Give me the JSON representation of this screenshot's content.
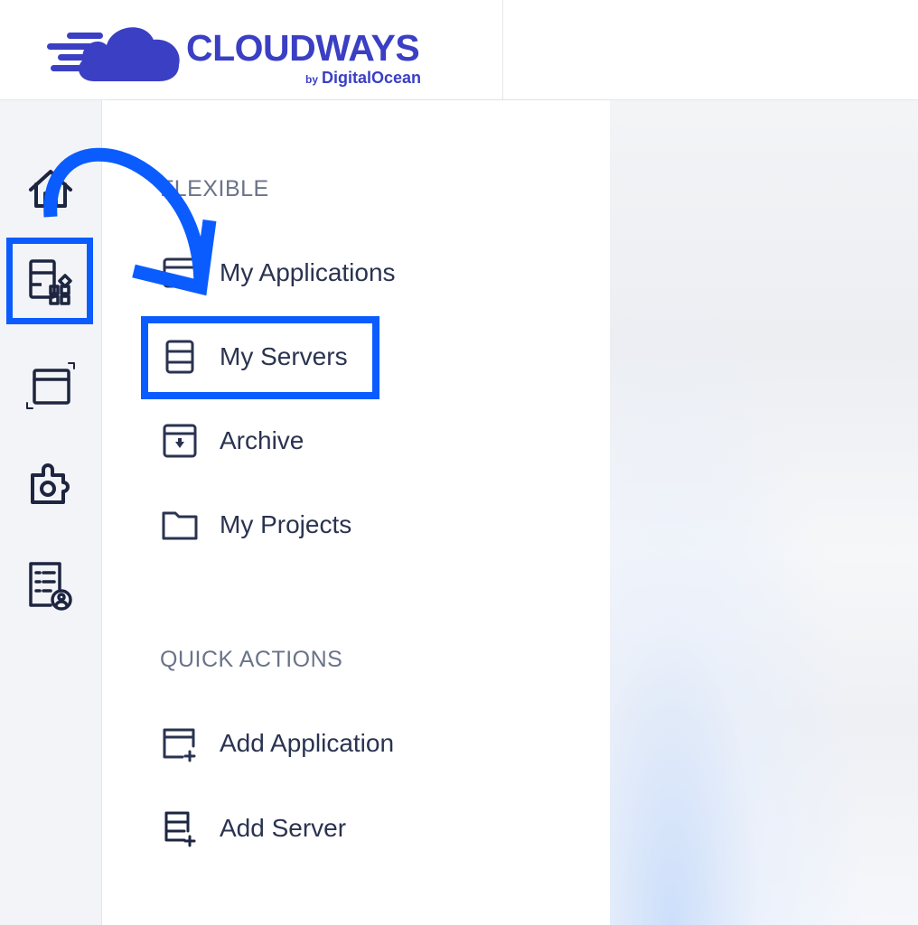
{
  "brand": {
    "name": "CLOUDWAYS",
    "by": "by",
    "partner": "DigitalOcean",
    "color": "#3a3fc4"
  },
  "accent_color": "#0a5cff",
  "rail": {
    "items": [
      {
        "icon": "home-icon"
      },
      {
        "icon": "applications-servers-icon",
        "active": true
      },
      {
        "icon": "window-resize-icon"
      },
      {
        "icon": "addons-puzzle-icon"
      },
      {
        "icon": "team-list-icon"
      }
    ]
  },
  "menu": {
    "flexible": {
      "title": "FLEXIBLE",
      "items": [
        {
          "label": "My Applications",
          "icon": "application-window-icon"
        },
        {
          "label": "My Servers",
          "icon": "server-icon",
          "highlighted": true
        },
        {
          "label": "Archive",
          "icon": "archive-icon"
        },
        {
          "label": "My Projects",
          "icon": "folder-icon"
        }
      ]
    },
    "quick_actions": {
      "title": "QUICK ACTIONS",
      "items": [
        {
          "label": "Add Application",
          "icon": "add-application-icon"
        },
        {
          "label": "Add Server",
          "icon": "add-server-icon"
        }
      ]
    }
  }
}
